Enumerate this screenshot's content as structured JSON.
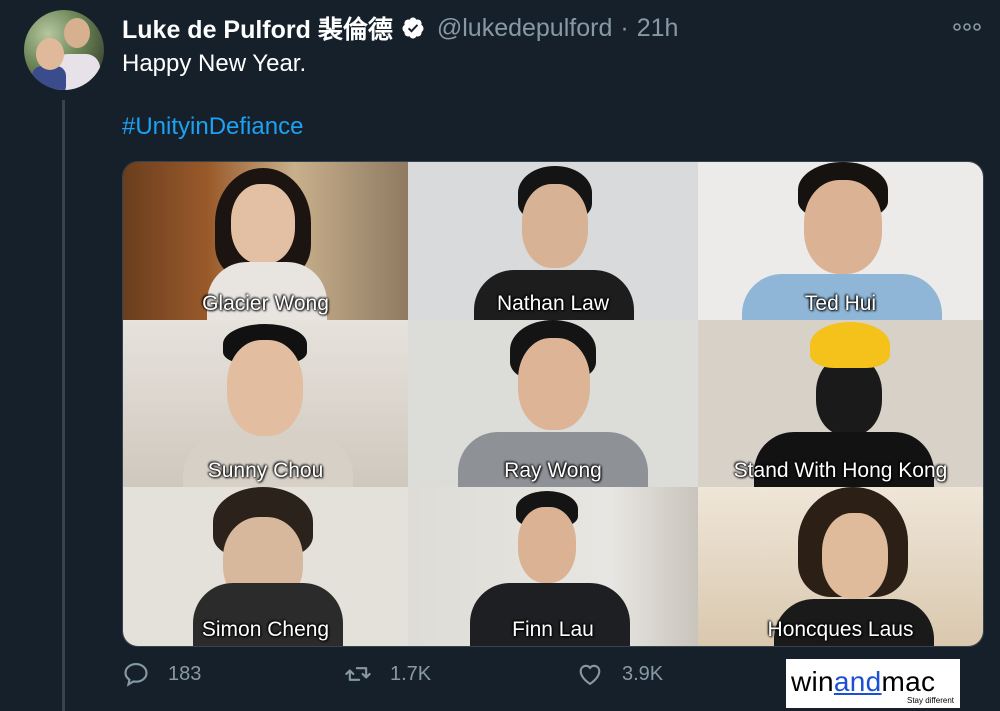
{
  "tweet": {
    "display_name": "Luke de Pulford 裴倫德",
    "handle": "@lukedepulford",
    "separator": "·",
    "time": "21h",
    "more_icon": "ellipsis-icon",
    "text": "Happy New Year.",
    "hashtag": "#UnityinDefiance"
  },
  "media": {
    "tiles": [
      {
        "label": "Glacier Wong"
      },
      {
        "label": "Nathan Law"
      },
      {
        "label": "Ted Hui"
      },
      {
        "label": "Sunny Chou"
      },
      {
        "label": "Ray Wong"
      },
      {
        "label": "Stand With Hong Kong"
      },
      {
        "label": "Simon Cheng"
      },
      {
        "label": "Finn Lau"
      },
      {
        "label": "Honcques Laus"
      }
    ]
  },
  "actions": {
    "reply_count": "183",
    "retweet_count": "1.7K",
    "like_count": "3.9K"
  },
  "watermark": {
    "win": "win",
    "and": "and",
    "mac": "mac",
    "tagline": "Stay different"
  },
  "colors": {
    "background": "#15202b",
    "link": "#1da1f2",
    "muted": "#8899a6"
  }
}
